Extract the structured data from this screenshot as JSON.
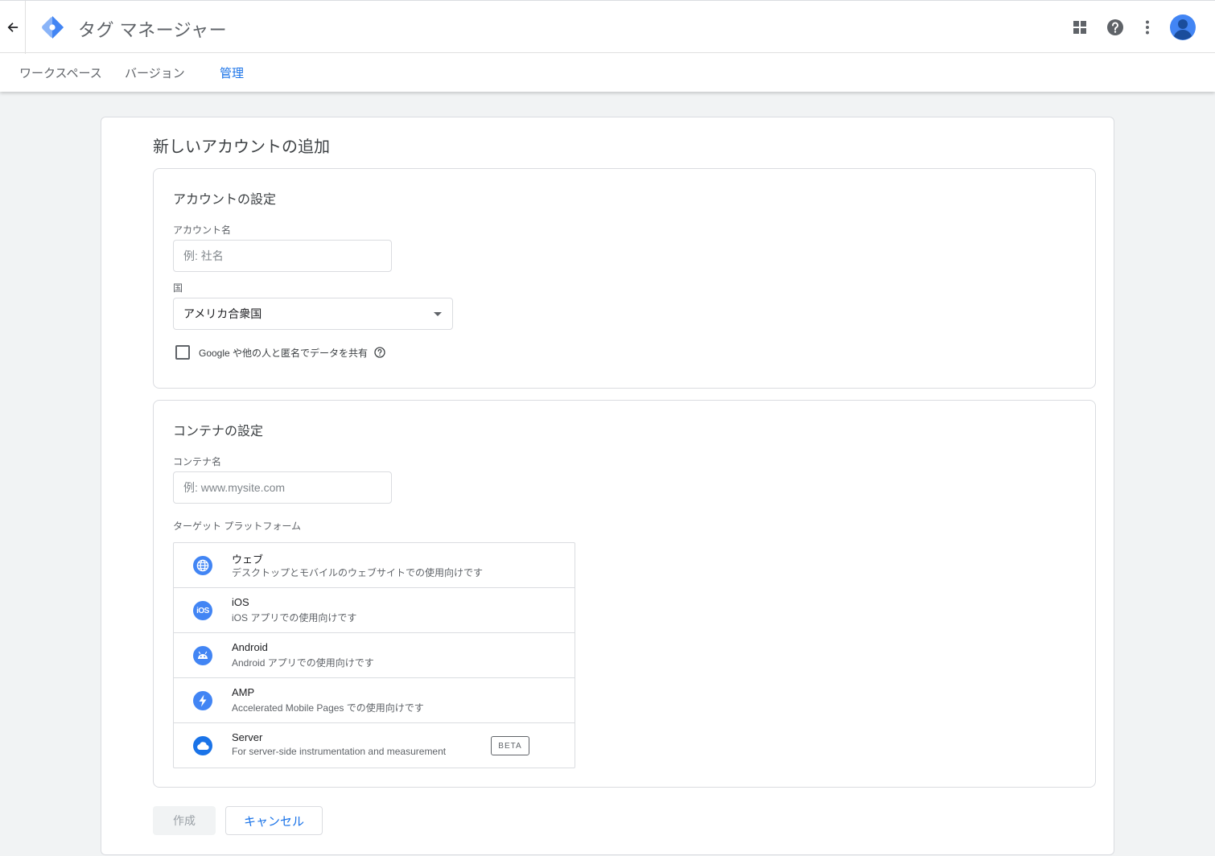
{
  "header": {
    "app_title": "タグ マネージャー",
    "icons": [
      "back-arrow-icon",
      "tag-manager-logo",
      "apps-grid-icon",
      "help-icon",
      "more-vert-icon",
      "account-avatar"
    ]
  },
  "tabs": [
    {
      "label": "ワークスペース",
      "active": false
    },
    {
      "label": "バージョン",
      "active": false
    },
    {
      "label": "管理",
      "active": true
    }
  ],
  "page": {
    "title": "新しいアカウントの追加"
  },
  "account_section": {
    "title": "アカウントの設定",
    "account_name_label": "アカウント名",
    "account_name_placeholder": "例: 社名",
    "account_name_value": "",
    "country_label": "国",
    "country_value": "アメリカ合衆国",
    "share_checkbox_label": "Google や他の人と匿名でデータを共有",
    "share_checked": false
  },
  "container_section": {
    "title": "コンテナの設定",
    "container_name_label": "コンテナ名",
    "container_name_placeholder": "例: www.mysite.com",
    "container_name_value": "",
    "platform_label": "ターゲット プラットフォーム",
    "platforms": [
      {
        "name": "ウェブ",
        "description": "デスクトップとモバイルのウェブサイトでの使用向けです",
        "icon": "globe-icon"
      },
      {
        "name": "iOS",
        "description": "iOS アプリでの使用向けです",
        "icon": "ios-icon"
      },
      {
        "name": "Android",
        "description": "Android アプリでの使用向けです",
        "icon": "android-icon"
      },
      {
        "name": "AMP",
        "description": "Accelerated Mobile Pages での使用向けです",
        "icon": "amp-bolt-icon"
      },
      {
        "name": "Server",
        "description": "For server-side instrumentation and measurement",
        "icon": "cloud-icon",
        "badge": "BETA"
      }
    ]
  },
  "actions": {
    "create_label": "作成",
    "cancel_label": "キャンセル"
  },
  "colors": {
    "accent": "#1a73e8",
    "icon_blue": "#4285f4",
    "background": "#f1f3f4"
  }
}
